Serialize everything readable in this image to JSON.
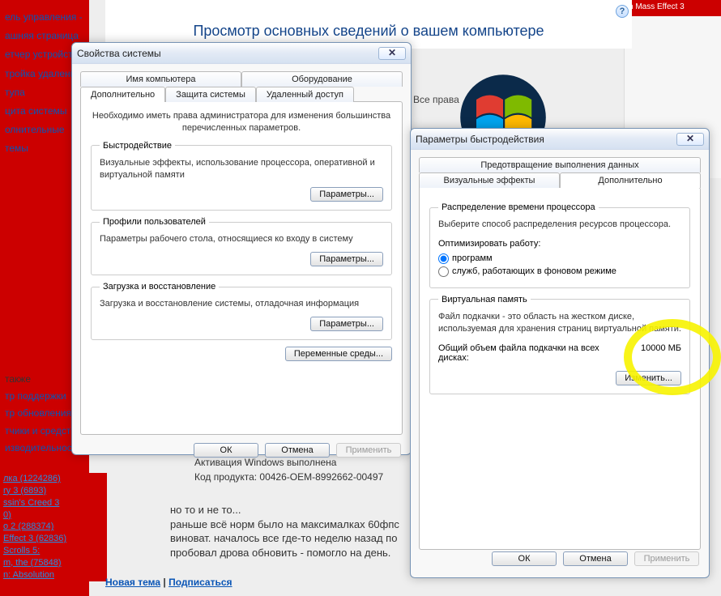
{
  "top_red_text": "n    Mass Effect 3",
  "controlPanel": {
    "title": "Просмотр основных сведений о вашем компьютере",
    "rights": "Все права",
    "activation_line1": "Активация Windows выполнена",
    "activation_line2": "Код продукта: 00426-OEM-8992662-00497",
    "help": "?"
  },
  "nav": {
    "item0": "ель управления -",
    "item1": "ашняя страница",
    "item2": "етчер устройств",
    "item3": "тройка удаленного",
    "item4": "тупа",
    "item5": "цита системы",
    "item6": "олнительные",
    "item7": "темы"
  },
  "lowerLinks": {
    "i0": " также",
    "i1": "тр поддержки",
    "i2": "тр обновления",
    "i3": "тчики и средства",
    "i4": "изводительности"
  },
  "redGames": {
    "g0": "лка (1224286)",
    "g1": "ry 3 (6893)",
    "g2": "ssin's Creed 3",
    "g3": "0)",
    "g4": "o 2 (288374)",
    "g5": "Effect 3 (62836)",
    "g6": "Scrolls 5:",
    "g7": "m, the (75848)",
    "g8": "n: Absolution"
  },
  "bottom": {
    "new_topic": "Новая тема",
    "subscribe": "Подписаться",
    "sep": " | "
  },
  "forum": {
    "l0": "но то и не то...",
    "l1": "раньше всё норм было на максималках 60фпс",
    "l2": "виноват. началось все где-то неделю назад по",
    "l3": "пробовал дрова обновить - помогло на день."
  },
  "dlg1": {
    "title": "Свойства системы",
    "tabs": {
      "name": "Имя компьютера",
      "hardware": "Оборудование",
      "advanced": "Дополнительно",
      "protection": "Защита системы",
      "remote": "Удаленный доступ"
    },
    "intro": "Необходимо иметь права администратора для изменения большинства перечисленных параметров.",
    "perf": {
      "legend": "Быстродействие",
      "desc": "Визуальные эффекты, использование процессора, оперативной и виртуальной памяти",
      "btn": "Параметры..."
    },
    "profiles": {
      "legend": "Профили пользователей",
      "desc": "Параметры рабочего стола, относящиеся ко входу в систему",
      "btn": "Параметры..."
    },
    "boot": {
      "legend": "Загрузка и восстановление",
      "desc": "Загрузка и восстановление системы, отладочная информация",
      "btn": "Параметры..."
    },
    "env_btn": "Переменные среды...",
    "ok": "ОК",
    "cancel": "Отмена",
    "apply": "Применить"
  },
  "dlg2": {
    "title": "Параметры быстродействия",
    "tabs": {
      "dep": "Предотвращение выполнения данных",
      "visual": "Визуальные эффекты",
      "advanced": "Дополнительно"
    },
    "cpu": {
      "legend": "Распределение времени процессора",
      "desc": "Выберите способ распределения ресурсов процессора.",
      "optimize": "Оптимизировать работу:",
      "radio_programs": "программ",
      "radio_services": "служб, работающих в фоновом режиме"
    },
    "vmem": {
      "legend": "Виртуальная память",
      "desc": "Файл подкачки - это область на жестком диске, используемая для хранения страниц виртуальной памяти.",
      "total_label": "Общий объем файла подкачки на всех дисках:",
      "total_value": "10000 МБ",
      "change_btn": "Изменить..."
    },
    "ok": "ОК",
    "cancel": "Отмена",
    "apply": "Применить"
  }
}
